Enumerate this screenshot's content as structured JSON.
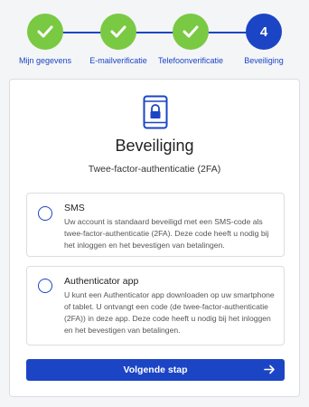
{
  "stepper": {
    "steps": [
      {
        "label": "Mijn gegevens",
        "state": "done"
      },
      {
        "label": "E-mailverificatie",
        "state": "done"
      },
      {
        "label": "Telefoonverificatie",
        "state": "done"
      },
      {
        "label": "Beveiliging",
        "state": "active",
        "number": "4"
      }
    ]
  },
  "card": {
    "icon": "phone-lock-icon",
    "title": "Beveiliging",
    "subtitle": "Twee-factor-authenticatie (2FA)",
    "options": [
      {
        "title": "SMS",
        "description": "Uw account is standaard beveiligd met een SMS-code als twee-factor-authenticatie (2FA). Deze code heeft u nodig bij het inloggen en het bevestigen van betalingen."
      },
      {
        "title": "Authenticator app",
        "description": "U kunt een Authenticator app downloaden op uw smartphone of tablet. U ontvangt een code (de twee-factor-authenticatie (2FA)) in deze app. Deze code heeft u nodig bij het inloggen en het bevestigen van betalingen."
      }
    ],
    "next_button": "Volgende stap"
  },
  "colors": {
    "primary": "#1b45c4",
    "done": "#7ac943"
  }
}
